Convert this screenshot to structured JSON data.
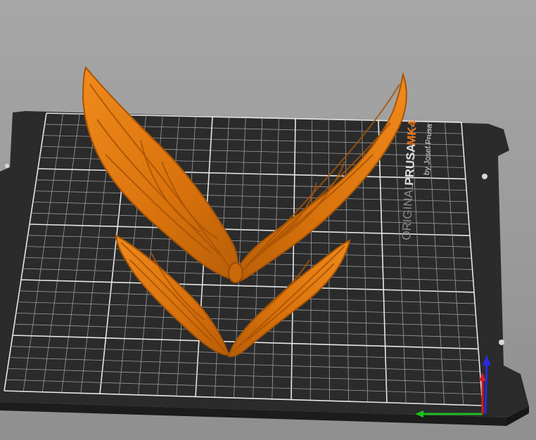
{
  "viewport": {
    "background": "#9c9c9c",
    "bed_color": "#2a2a2a",
    "grid_color": "#d8d8d8",
    "model_color": "#e67e10"
  },
  "bed": {
    "logo_prefix": "ORIGINAL",
    "logo_brand": "PRUSA",
    "logo_model": "MK4",
    "logo_byline": "by Josef Prusa"
  },
  "model": {
    "objects": [
      "upper-wings",
      "lower-wings"
    ]
  },
  "axes": {
    "x_color": "#1fbf1f",
    "y_color": "#d01f1f",
    "z_color": "#2a2adf"
  }
}
